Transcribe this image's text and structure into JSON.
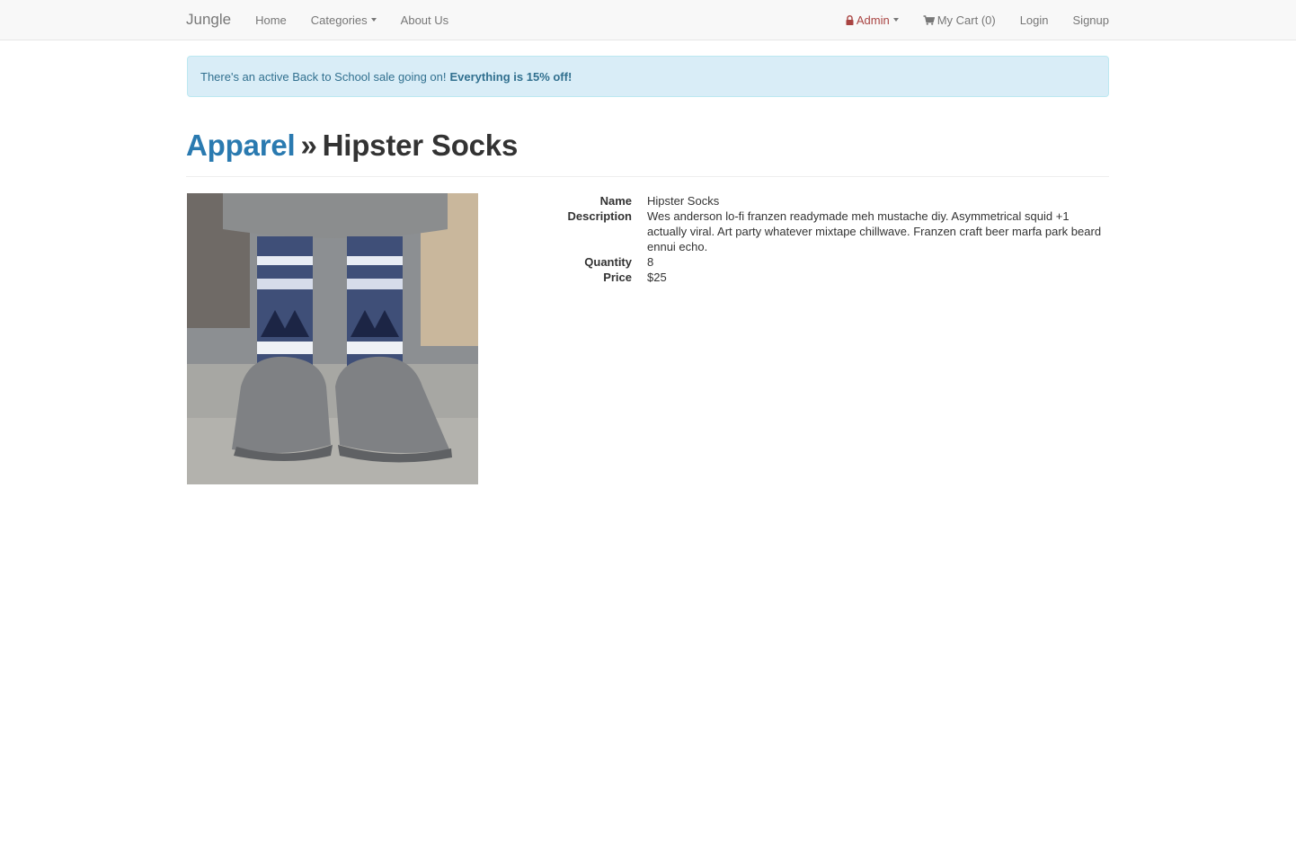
{
  "navbar": {
    "brand": "Jungle",
    "links": {
      "home": "Home",
      "categories": "Categories",
      "about": "About Us"
    },
    "right": {
      "admin": "Admin",
      "cart": "My Cart (0)",
      "login": "Login",
      "signup": "Signup"
    }
  },
  "alert": {
    "message": "There's an active Back to School sale going on!",
    "emphasis": "Everything is 15% off!"
  },
  "header": {
    "category": "Apparel",
    "separator": "»",
    "title": "Hipster Socks"
  },
  "product": {
    "image_icon": "hipster-socks-photo",
    "fields": [
      {
        "label": "Name",
        "value": "Hipster Socks"
      },
      {
        "label": "Description",
        "value": "Wes anderson lo-fi franzen readymade meh mustache diy. Asymmetrical squid +1 actually viral. Art party whatever mixtape chillwave. Franzen craft beer marfa park beard ennui echo."
      },
      {
        "label": "Quantity",
        "value": "8"
      },
      {
        "label": "Price",
        "value": "$25"
      }
    ]
  },
  "colors": {
    "link": "#2a7ab0",
    "admin": "#a94442",
    "alert_bg": "#d9edf7",
    "alert_text": "#31708f",
    "navbar_bg": "#f8f8f8"
  }
}
